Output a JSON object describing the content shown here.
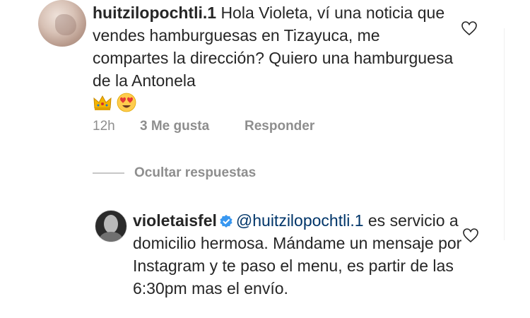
{
  "comments": [
    {
      "username": "huitzilopochtli.1",
      "text": "Hola Violeta, ví una noticia que vendes hamburguesas en Tizayuca, me compartes la dirección? Quiero una hamburguesa de la Antonela",
      "emojis": [
        "crown-emoji",
        "heart-eyes-emoji"
      ],
      "time": "12h",
      "likes": "3 Me gusta",
      "reply_label": "Responder"
    }
  ],
  "replies_toggle": "Ocultar respuestas",
  "reply": {
    "username": "violetaisfel",
    "verified_icon": "verified-badge-icon",
    "mention": "@huitzilopochtli.1",
    "text": " es servicio a domicilio hermosa. Mándame un mensaje por Instagram y te paso el menu, es partir de las 6:30pm mas el envío."
  },
  "icons": {
    "like": "heart-outline-icon"
  },
  "colors": {
    "text": "#262626",
    "secondary": "#8e8e8e",
    "link": "#003569",
    "verified": "#3897f0"
  }
}
